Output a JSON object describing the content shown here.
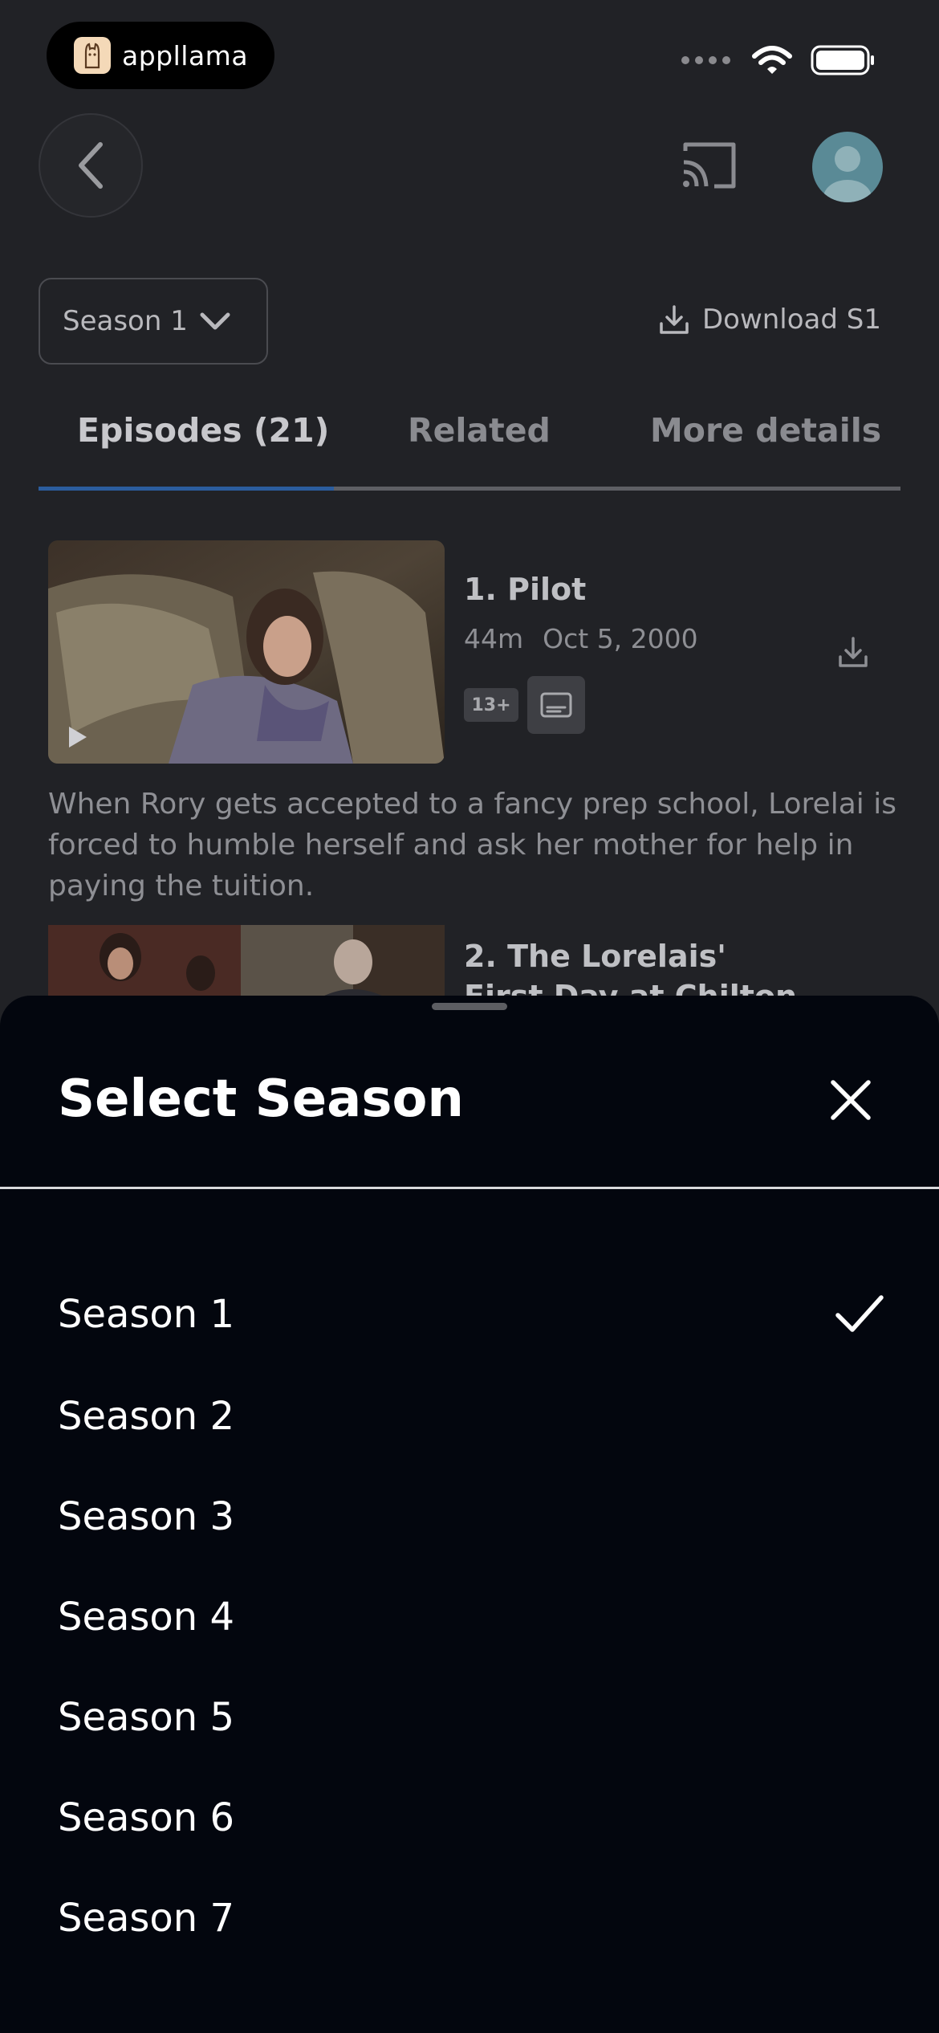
{
  "status_bar": {
    "app_name": "appllama",
    "icons": [
      "signal-icon",
      "wifi-icon",
      "battery-icon"
    ]
  },
  "header": {
    "icons": [
      "back-icon",
      "cast-icon",
      "avatar-icon"
    ]
  },
  "season_selector": {
    "current": "Season 1",
    "download_label": "Download S1"
  },
  "tabs": [
    {
      "label": "Episodes (21)",
      "active": true
    },
    {
      "label": "Related",
      "active": false
    },
    {
      "label": "More details",
      "active": false
    }
  ],
  "episodes": [
    {
      "title": "1. Pilot",
      "duration": "44m",
      "date": "Oct 5, 2000",
      "rating": "13+",
      "description": "When Rory gets accepted to a fancy prep school, Lorelai is forced to humble herself and ask her mother for help in paying the tuition."
    },
    {
      "title_line1": "2. The Lorelais'",
      "title_line2": "First Day at Chilton"
    }
  ],
  "sheet": {
    "title": "Select Season",
    "selected": "Season 1",
    "seasons": [
      "Season 1",
      "Season 2",
      "Season 3",
      "Season 4",
      "Season 5",
      "Season 6",
      "Season 7"
    ]
  },
  "colors": {
    "background": "#212226",
    "sheet_background": "#03060e",
    "tab_indicator": "#2b5d9e",
    "text_primary": "#ffffff"
  }
}
